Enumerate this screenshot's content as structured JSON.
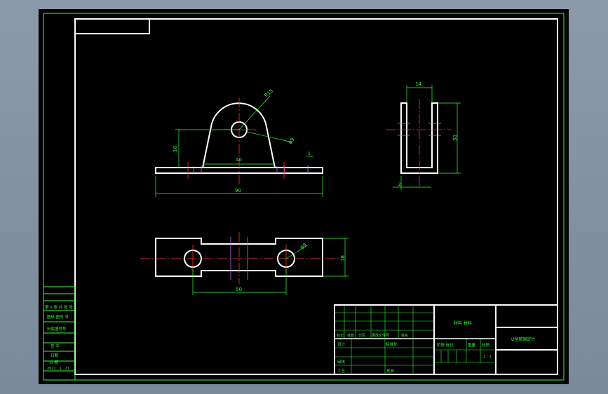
{
  "views": {
    "front": {
      "radius_label": "R15",
      "hole_label": "φ9",
      "height_label": "10",
      "inner_width_label": "40",
      "thickness_label": "1",
      "overall_width_label": "90"
    },
    "side": {
      "top_label": "14",
      "height_label": "30",
      "bottom_label": "2"
    },
    "plan": {
      "hole_label": "φ9",
      "height_label": "18",
      "spacing_label": "50"
    }
  },
  "side_strip": {
    "cell1": "第 1 张  共 张 张",
    "cell2": "图纸 图号 号",
    "cell3": "旧底图号号",
    "cell4": "签  字",
    "cell5": "日期",
    "cell6": "日  期",
    "cell7": "2021 . 1 . 21"
  },
  "title_block": {
    "row1": [
      "标记",
      "处数",
      "分区",
      "更改文件号",
      "签名"
    ],
    "designer": "设计",
    "standardize": "标准化",
    "checker": "审核",
    "process": "工艺",
    "approve": "批准",
    "material": "材料 材料",
    "stage_mark": "阶段 标记",
    "weight": "重量",
    "scale": "比例",
    "scale_value": "1 : 1",
    "part_name": "U型管固定片"
  }
}
